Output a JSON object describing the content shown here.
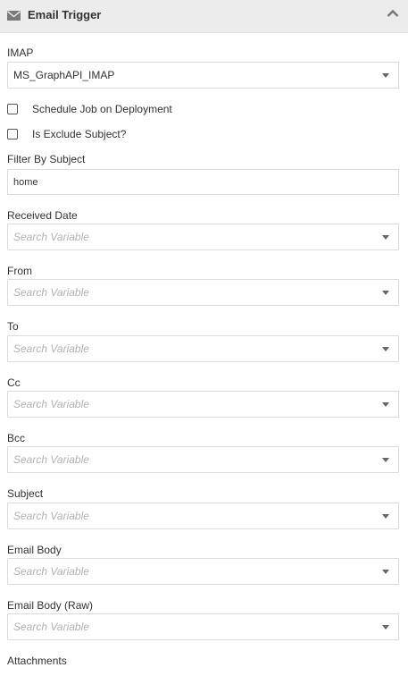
{
  "panel": {
    "title": "Email Trigger",
    "icon": "envelope-icon",
    "collapse_icon": "chevron-up-icon"
  },
  "imap": {
    "label": "IMAP",
    "value": "MS_GraphAPI_IMAP"
  },
  "checkboxes": {
    "schedule": {
      "label": "Schedule Job on Deployment",
      "checked": false
    },
    "exclude_subject": {
      "label": "Is Exclude Subject?",
      "checked": false
    }
  },
  "filter_by_subject": {
    "label": "Filter By Subject",
    "value": "home"
  },
  "fields": [
    {
      "label": "Received Date",
      "placeholder": "Search Variable"
    },
    {
      "label": "From",
      "placeholder": "Search Variable"
    },
    {
      "label": "To",
      "placeholder": "Search Variable"
    },
    {
      "label": "Cc",
      "placeholder": "Search Variable"
    },
    {
      "label": "Bcc",
      "placeholder": "Search Variable"
    },
    {
      "label": "Subject",
      "placeholder": "Search Variable"
    },
    {
      "label": "Email Body",
      "placeholder": "Search Variable"
    },
    {
      "label": "Email Body (Raw)",
      "placeholder": "Search Variable"
    },
    {
      "label": "Attachments"
    }
  ]
}
